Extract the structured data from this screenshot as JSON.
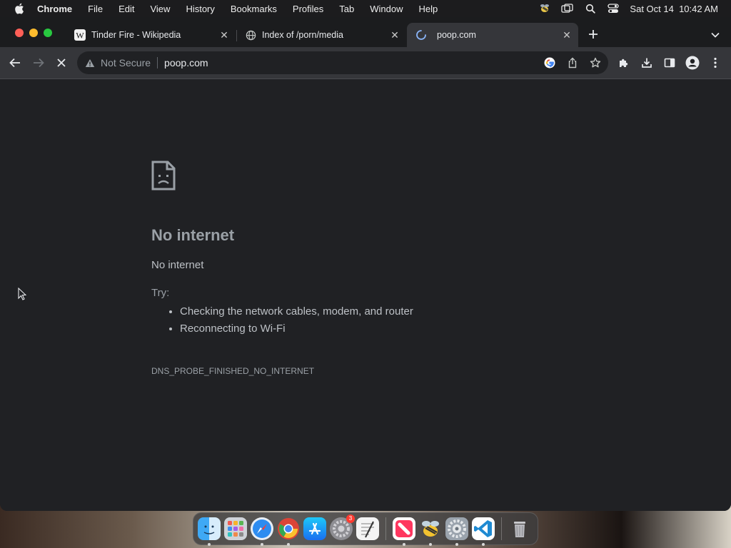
{
  "menubar": {
    "app_name": "Chrome",
    "menus": [
      "File",
      "Edit",
      "View",
      "History",
      "Bookmarks",
      "Profiles",
      "Tab",
      "Window",
      "Help"
    ],
    "datetime": "Sat Oct 14  10:42 AM"
  },
  "tabs": [
    {
      "title": "Tinder Fire - Wikipedia",
      "favicon": "wikipedia-icon",
      "active": false
    },
    {
      "title": "Index of /porn/media",
      "favicon": "globe-icon",
      "active": false
    },
    {
      "title": "poop.com",
      "favicon": "loading-spinner-icon",
      "active": true
    }
  ],
  "toolbar": {
    "security_label": "Not Secure",
    "url": "poop.com"
  },
  "error_page": {
    "title": "No internet",
    "subtitle": "No internet",
    "try_label": "Try:",
    "suggestions": [
      "Checking the network cables, modem, and router",
      "Reconnecting to Wi-Fi"
    ],
    "error_code": "DNS_PROBE_FINISHED_NO_INTERNET"
  },
  "dock": {
    "apps": [
      "finder",
      "launchpad",
      "safari",
      "chrome",
      "app-store",
      "system-settings",
      "textedit",
      "news",
      "bee-app",
      "system-preferences",
      "vscode",
      "trash"
    ],
    "system_settings_badge": "3"
  },
  "colors": {
    "page_bg": "#202124",
    "toolbar_bg": "#35363a",
    "tabstrip_bg": "#1b1c1e",
    "text_secondary": "#9aa0a6",
    "text_primary": "#bdc1c6"
  }
}
